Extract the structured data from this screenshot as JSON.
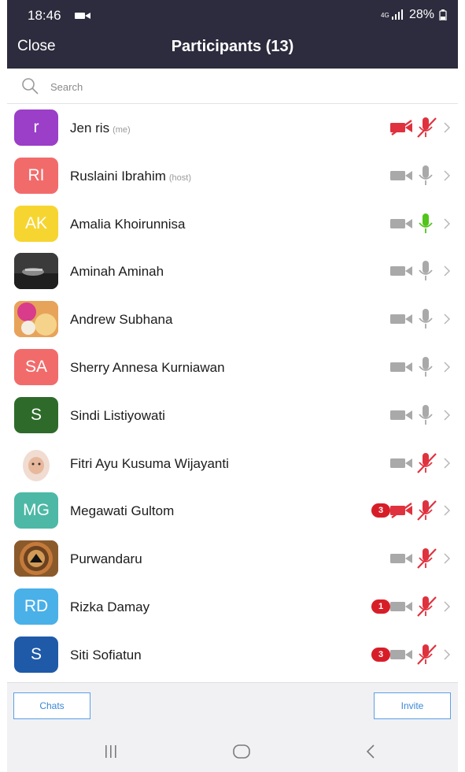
{
  "status_bar": {
    "time": "18:46",
    "battery": "28%"
  },
  "header": {
    "close_label": "Close",
    "title": "Participants (13)"
  },
  "search": {
    "placeholder": "Search"
  },
  "participants": [
    {
      "initials": "r",
      "avatar_color": "#9b3ec8",
      "name": "Jen ris",
      "tag": "(me)",
      "badge": "",
      "video": "off",
      "audio": "muted"
    },
    {
      "initials": "RI",
      "avatar_color": "#f26b6b",
      "name": "Ruslaini Ibrahim",
      "tag": "(host)",
      "badge": "",
      "video": "on",
      "audio": "on"
    },
    {
      "initials": "AK",
      "avatar_color": "#f7d531",
      "name": "Amalia Khoirunnisa",
      "tag": "",
      "badge": "",
      "video": "on",
      "audio": "speaking"
    },
    {
      "initials": "",
      "avatar_color": "#4a4a4a",
      "name": "Aminah Aminah",
      "tag": "",
      "badge": "",
      "video": "on",
      "audio": "on",
      "photo": "dark"
    },
    {
      "initials": "",
      "avatar_color": "#d98a4a",
      "name": "Andrew Subhana",
      "tag": "",
      "badge": "",
      "video": "on",
      "audio": "on",
      "photo": "colorful"
    },
    {
      "initials": "SA",
      "avatar_color": "#f26b6b",
      "name": "Sherry Annesa Kurniawan",
      "tag": "",
      "badge": "",
      "video": "on",
      "audio": "on"
    },
    {
      "initials": "S",
      "avatar_color": "#2e6b2a",
      "name": "Sindi Listiyowati",
      "tag": "",
      "badge": "",
      "video": "on",
      "audio": "on"
    },
    {
      "initials": "",
      "avatar_color": "#f3e4d8",
      "name": "Fitri Ayu Kusuma Wijayanti",
      "tag": "",
      "badge": "",
      "video": "on",
      "audio": "muted",
      "photo": "hijab"
    },
    {
      "initials": "MG",
      "avatar_color": "#4db8a6",
      "name": "Megawati Gultom",
      "tag": "",
      "badge": "3",
      "video": "off",
      "audio": "muted"
    },
    {
      "initials": "",
      "avatar_color": "#a0522d",
      "name": "Purwandaru",
      "tag": "",
      "badge": "",
      "video": "on",
      "audio": "muted",
      "photo": "rings"
    },
    {
      "initials": "RD",
      "avatar_color": "#4ab0e8",
      "name": "Rizka Damay",
      "tag": "",
      "badge": "1",
      "video": "on",
      "audio": "muted"
    },
    {
      "initials": "S",
      "avatar_color": "#1f5aa8",
      "name": "Siti Sofiatun",
      "tag": "",
      "badge": "3",
      "video": "on",
      "audio": "muted"
    }
  ],
  "bottom_bar": {
    "chats_label": "Chats",
    "invite_label": "Invite"
  },
  "colors": {
    "header_bg": "#2c2c3e",
    "muted_red": "#e0323e",
    "speaking_green": "#52c41a",
    "icon_gray": "#a9a9a9",
    "accent_blue": "#3b87d8"
  },
  "icons": [
    "search-icon",
    "video-icon",
    "video-off-icon",
    "mic-icon",
    "mic-muted-icon",
    "chevron-right-icon",
    "nav-recents-icon",
    "nav-home-icon",
    "nav-back-icon"
  ]
}
